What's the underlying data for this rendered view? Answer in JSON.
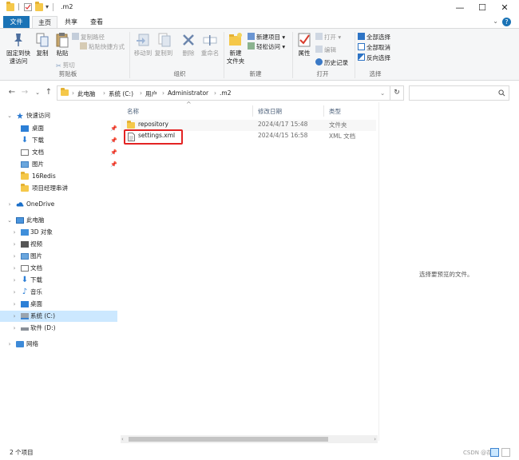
{
  "window": {
    "title": ".m2",
    "controls": {
      "minimize": "—",
      "maximize": "☐",
      "close": "✕"
    }
  },
  "ribbon_tabs": [
    "文件",
    "主页",
    "共享",
    "查看"
  ],
  "ribbon": {
    "clipboard": {
      "pin_label": "固定到快\n速访问",
      "copy_label": "复制",
      "paste_label": "粘贴",
      "copy_path": "复制路径",
      "paste_shortcut": "粘贴快捷方式",
      "cut": "剪切",
      "group": "剪贴板"
    },
    "organize": {
      "move_to": "移动到",
      "copy_to": "复制到",
      "delete": "删除",
      "rename": "重命名",
      "group": "组织"
    },
    "new": {
      "new_folder": "新建\n文件夹",
      "new_item": "新建项目 ▾",
      "easy_access": "轻松访问 ▾",
      "group": "新建"
    },
    "open": {
      "properties": "属性",
      "open": "打开 ▾",
      "edit": "编辑",
      "history": "历史记录",
      "group": "打开"
    },
    "select": {
      "select_all": "全部选择",
      "select_none": "全部取消",
      "invert": "反向选择",
      "group": "选择"
    }
  },
  "address": {
    "crumbs": [
      "此电脑",
      "系统 (C:)",
      "用户",
      "Administrator",
      ".m2"
    ]
  },
  "nav": {
    "quick_access": "快速访问",
    "quick_items": [
      "桌面",
      "下载",
      "文档",
      "图片",
      "16Redis",
      "项目经理串讲"
    ],
    "onedrive": "OneDrive",
    "this_pc": "此电脑",
    "pc_items": [
      "3D 对象",
      "视频",
      "图片",
      "文档",
      "下载",
      "音乐",
      "桌面",
      "系统 (C:)",
      "软件 (D:)"
    ],
    "network": "网络"
  },
  "columns": {
    "name": "名称",
    "date": "修改日期",
    "type": "类型"
  },
  "files": [
    {
      "name": "repository",
      "date": "2024/4/17 15:48",
      "type": "文件夹",
      "icon": "folder-icon"
    },
    {
      "name": "settings.xml",
      "date": "2024/4/15 16:58",
      "type": "XML 文档",
      "icon": "xml-file-icon"
    }
  ],
  "preview": {
    "message": "选择要预览的文件。"
  },
  "status": {
    "count": "2 个项目"
  },
  "watermark": "CSDN @花后",
  "colors": {
    "accent": "#1a73b6",
    "selection": "#cce8ff",
    "highlight_box": "#e32323",
    "folder": "#f5c84a"
  }
}
